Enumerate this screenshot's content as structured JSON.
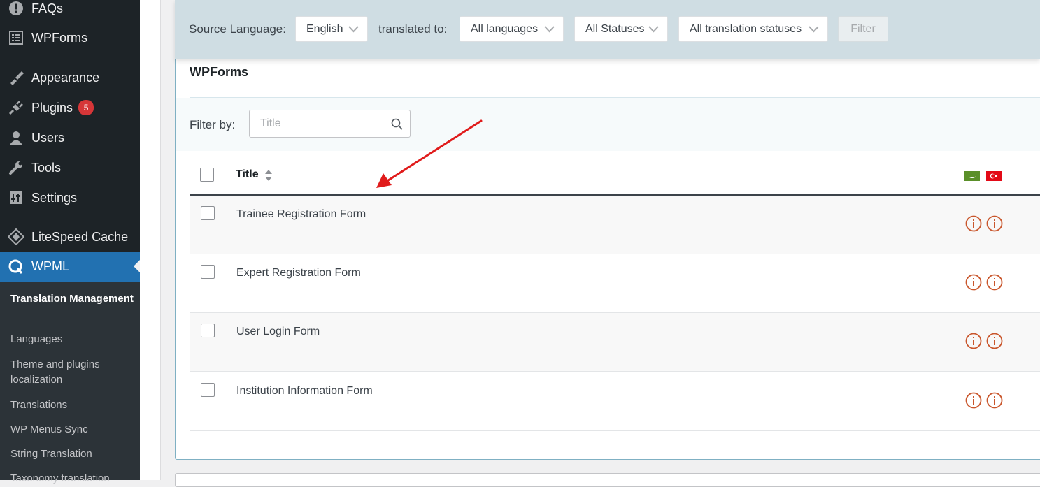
{
  "sidebar": {
    "items": [
      {
        "label": "FAQs",
        "icon": "exclamation-icon"
      },
      {
        "label": "WPForms",
        "icon": "form-icon"
      },
      {
        "label": "Appearance",
        "icon": "paintbrush-icon"
      },
      {
        "label": "Plugins",
        "icon": "plug-icon",
        "badge": "5"
      },
      {
        "label": "Users",
        "icon": "user-icon"
      },
      {
        "label": "Tools",
        "icon": "wrench-icon"
      },
      {
        "label": "Settings",
        "icon": "sliders-icon"
      },
      {
        "label": "LiteSpeed Cache",
        "icon": "diamond-icon"
      },
      {
        "label": "WPML",
        "icon": "wpml-icon",
        "active": true
      }
    ],
    "submenu": [
      {
        "label": "Translation Management",
        "current": true
      },
      {
        "label": "Languages"
      },
      {
        "label": "Theme and plugins localization"
      },
      {
        "label": "Translations"
      },
      {
        "label": "WP Menus Sync"
      },
      {
        "label": "String Translation"
      },
      {
        "label": "Taxonomy translation"
      }
    ]
  },
  "filter_bar": {
    "source_language_label": "Source Language:",
    "source_language_value": "English",
    "translated_to_label": "translated to:",
    "languages_value": "All languages",
    "statuses_value": "All Statuses",
    "translation_statuses_value": "All translation statuses",
    "filter_button": "Filter"
  },
  "section": {
    "title": "WPForms",
    "filter_by_label": "Filter by:",
    "search_placeholder": "Title"
  },
  "table": {
    "title_header": "Title",
    "language_flags": [
      "arabic-flag-icon",
      "turkey-flag-icon"
    ],
    "rows": [
      {
        "title": "Trainee Registration Form"
      },
      {
        "title": "Expert Registration Form"
      },
      {
        "title": "User Login Form"
      },
      {
        "title": "Institution Information Form"
      }
    ]
  },
  "colors": {
    "sidebar_bg": "#1d2327",
    "active_menu": "#2271b1",
    "badge": "#d63638",
    "filter_bar_bg": "#cfdde3",
    "status_icon": "#c9562c",
    "annotation_arrow": "#e01b1b"
  }
}
